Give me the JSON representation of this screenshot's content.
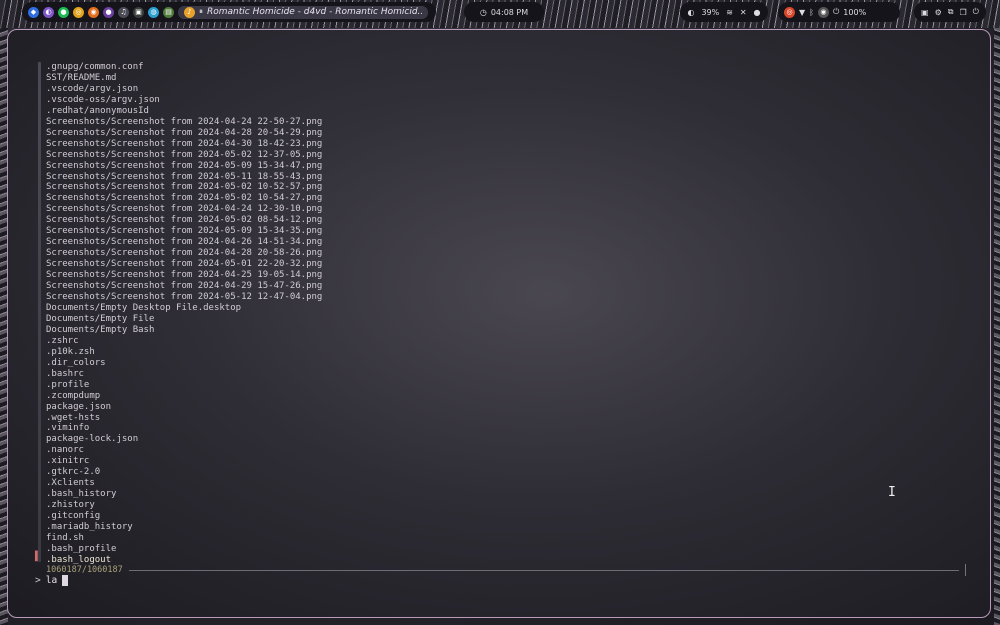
{
  "topbar": {
    "apps": [
      {
        "icon": "arch-icon",
        "color": "#2f6ee0"
      },
      {
        "icon": "firefox-icon",
        "color": "#7e55c9"
      },
      {
        "icon": "spotify-icon",
        "color": "#1db954"
      },
      {
        "icon": "chrome-icon",
        "color": "#e0a31a"
      },
      {
        "icon": "firefox-orange-icon",
        "color": "#e26d1c"
      },
      {
        "icon": "obsidian-icon",
        "color": "#6b3fa0"
      },
      {
        "icon": "music-icon",
        "color": "#4a4a55"
      },
      {
        "icon": "terminal-icon",
        "color": "#3a3f3a"
      },
      {
        "icon": "browser-icon",
        "color": "#2a9fd0"
      },
      {
        "icon": "game-icon",
        "color": "#4f7a3a"
      }
    ],
    "window_title": "Romantic Homicide - d4vd - Romantic Homicid…",
    "clock": "04:08 PM",
    "brightness": "39%",
    "battery": "100%"
  },
  "terminal": {
    "entries": [
      ".gnupg/common.conf",
      "SST/README.md",
      ".vscode/argv.json",
      ".vscode-oss/argv.json",
      ".redhat/anonymousId",
      "Screenshots/Screenshot from 2024-04-24 22-50-27.png",
      "Screenshots/Screenshot from 2024-04-28 20-54-29.png",
      "Screenshots/Screenshot from 2024-04-30 18-42-23.png",
      "Screenshots/Screenshot from 2024-05-02 12-37-05.png",
      "Screenshots/Screenshot from 2024-05-09 15-34-47.png",
      "Screenshots/Screenshot from 2024-05-11 18-55-43.png",
      "Screenshots/Screenshot from 2024-05-02 10-52-57.png",
      "Screenshots/Screenshot from 2024-05-02 10-54-27.png",
      "Screenshots/Screenshot from 2024-04-24 12-30-10.png",
      "Screenshots/Screenshot from 2024-05-02 08-54-12.png",
      "Screenshots/Screenshot from 2024-05-09 15-34-35.png",
      "Screenshots/Screenshot from 2024-04-26 14-51-34.png",
      "Screenshots/Screenshot from 2024-04-28 20-58-26.png",
      "Screenshots/Screenshot from 2024-05-01 22-20-32.png",
      "Screenshots/Screenshot from 2024-04-25 19-05-14.png",
      "Screenshots/Screenshot from 2024-04-29 15-47-26.png",
      "Screenshots/Screenshot from 2024-05-12 12-47-04.png",
      "Documents/Empty Desktop File.desktop",
      "Documents/Empty File",
      "Documents/Empty Bash",
      ".zshrc",
      ".p10k.zsh",
      ".dir_colors",
      ".bashrc",
      ".profile",
      ".zcompdump",
      "package.json",
      ".wget-hsts",
      ".viminfo",
      "package-lock.json",
      ".nanorc",
      ".xinitrc",
      ".gtkrc-2.0",
      ".Xclients",
      ".bash_history",
      ".zhistory",
      ".gitconfig",
      ".mariadb_history",
      "find.sh",
      ".bash_profile",
      ".bash_logout"
    ],
    "count": "1060187/1060187",
    "prompt_symbol": ">",
    "query": "la"
  }
}
